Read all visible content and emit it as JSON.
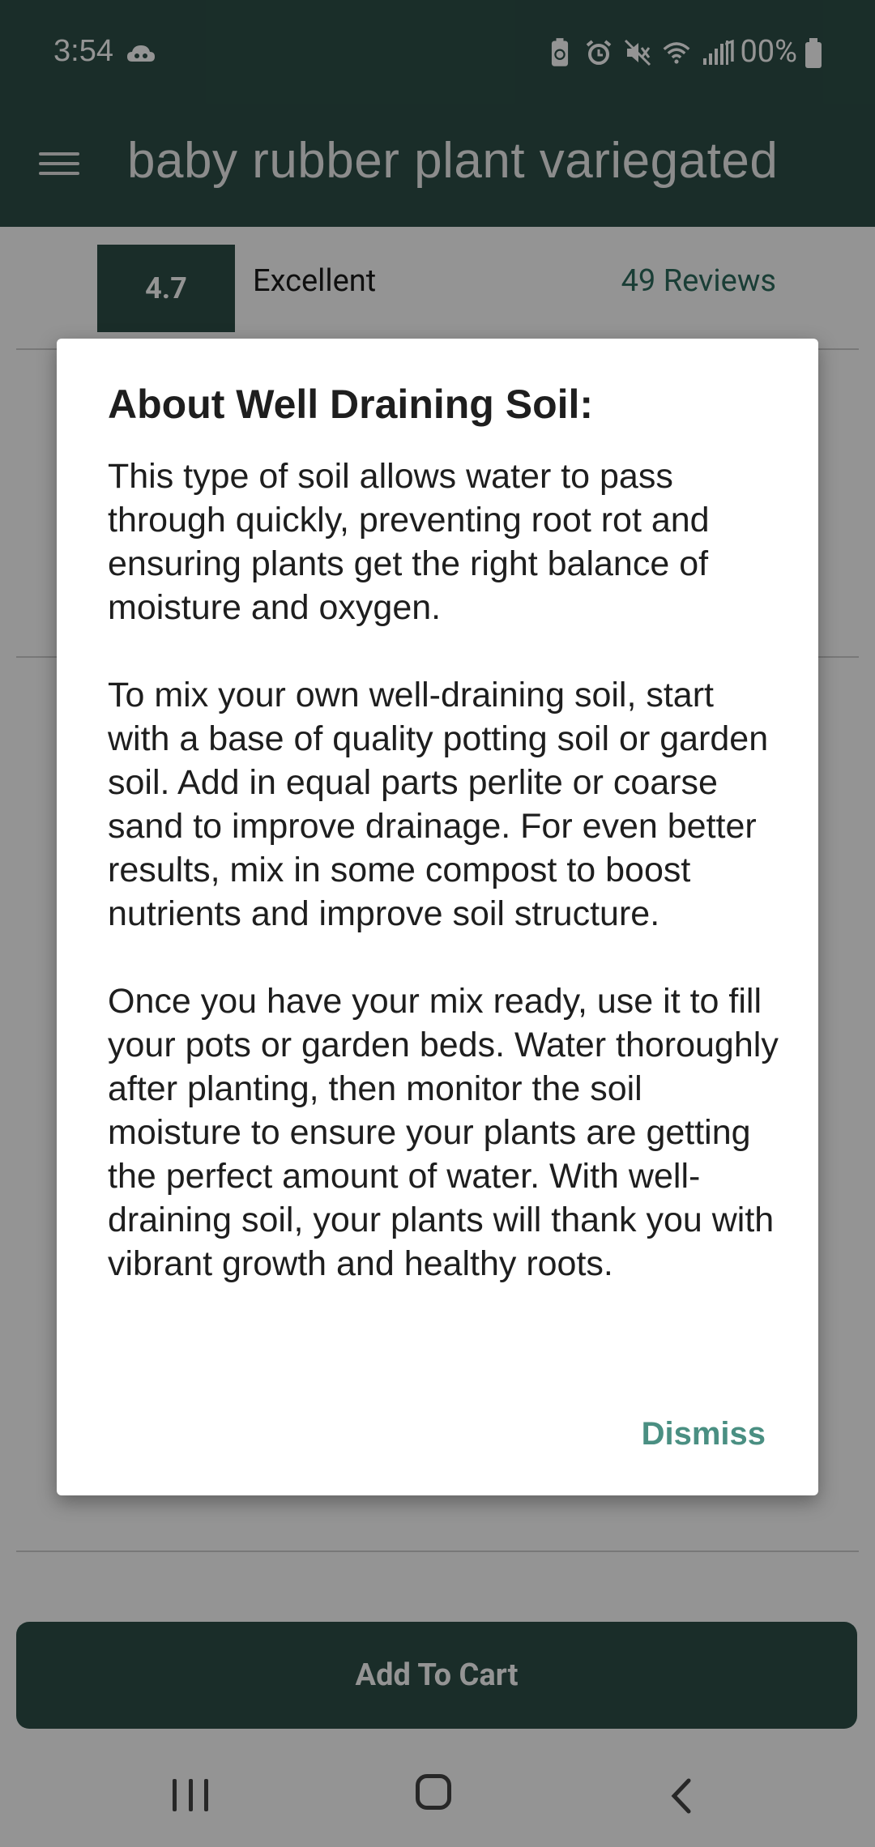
{
  "status_bar": {
    "time": "3:54",
    "battery_pct": "100%",
    "icons": [
      "cloud-game-icon",
      "battery-saver-icon",
      "alarm-icon",
      "mute-icon",
      "wifi-icon",
      "signal-icon",
      "battery-icon"
    ]
  },
  "app_bar": {
    "title": "baby rubber plant variegated"
  },
  "product": {
    "rating": "4.7",
    "rating_word": "Excellent",
    "reviews": "49 Reviews",
    "cart_label": "Add To Cart"
  },
  "dialog": {
    "title": "About Well Draining Soil:",
    "body": "This type of soil allows water to pass through quickly, preventing root rot and ensuring plants get the right balance of moisture and oxygen.\n\nTo mix your own well-draining soil, start with a base of quality potting soil or garden soil. Add in equal parts perlite or coarse sand to improve drainage. For even better results, mix in some compost to boost nutrients and improve soil structure.\n\nOnce you have your mix ready, use it to fill your pots or garden beds. Water thoroughly after planting, then monitor the soil moisture to ensure your plants are getting the perfect amount of water. With well-draining soil, your plants will thank you with vibrant growth and healthy roots.",
    "dismiss_label": "Dismiss"
  },
  "colors": {
    "primary": "#2d4f47",
    "accent": "#4a8f82"
  }
}
